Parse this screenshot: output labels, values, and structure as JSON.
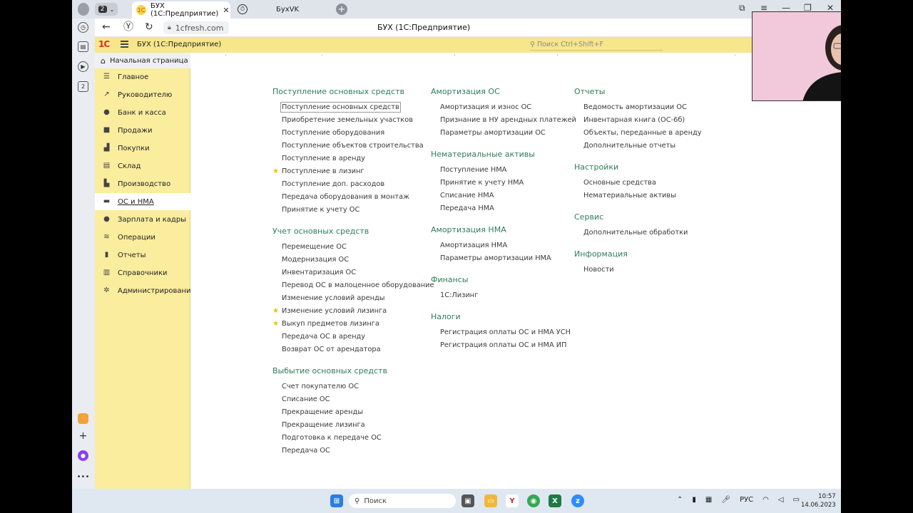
{
  "browser": {
    "profile_count": "2",
    "tabs": [
      {
        "label": "БУХ (1С:Предприятие)",
        "active": true
      },
      {
        "label": "БухVK",
        "active": false
      }
    ],
    "url": "1cfresh.com",
    "page_title": "БУХ (1С:Предприятие)",
    "rail_badge": "2"
  },
  "app": {
    "title": "БУХ  (1С:Предприятие)",
    "search_placeholder": "Поиск Ctrl+Shift+F",
    "home_tab": "Начальная страница"
  },
  "sidebar": {
    "items": [
      {
        "label": "Главное",
        "icon": "list-icon"
      },
      {
        "label": "Руководителю",
        "icon": "trend-icon"
      },
      {
        "label": "Банк и касса",
        "icon": "coin-icon"
      },
      {
        "label": "Продажи",
        "icon": "bag-icon"
      },
      {
        "label": "Покупки",
        "icon": "cart-icon"
      },
      {
        "label": "Склад",
        "icon": "box-icon"
      },
      {
        "label": "Производство",
        "icon": "factory-icon"
      },
      {
        "label": "ОС и НМА",
        "icon": "truck-icon",
        "active": true
      },
      {
        "label": "Зарплата и кадры",
        "icon": "person-icon"
      },
      {
        "label": "Операции",
        "icon": "ops-icon"
      },
      {
        "label": "Отчеты",
        "icon": "bar-chart-icon"
      },
      {
        "label": "Справочники",
        "icon": "book-icon"
      },
      {
        "label": "Администрирование",
        "icon": "gear-icon"
      }
    ]
  },
  "content": {
    "col1": [
      {
        "title": "Поступление основных средств",
        "links": [
          {
            "label": "Поступление основных средств",
            "boxed": true
          },
          {
            "label": "Приобретение земельных участков"
          },
          {
            "label": "Поступление оборудования"
          },
          {
            "label": "Поступление объектов строительства"
          },
          {
            "label": "Поступление в аренду"
          },
          {
            "label": "Поступление в лизинг",
            "star": true
          },
          {
            "label": "Поступление доп. расходов"
          },
          {
            "label": "Передача оборудования в монтаж"
          },
          {
            "label": "Принятие к учету ОС"
          }
        ]
      },
      {
        "title": "Учет основных средств",
        "links": [
          {
            "label": "Перемещение ОС"
          },
          {
            "label": "Модернизация ОС"
          },
          {
            "label": "Инвентаризация ОС"
          },
          {
            "label": "Перевод ОС в малоценное оборудование"
          },
          {
            "label": "Изменение условий аренды"
          },
          {
            "label": "Изменение условий лизинга",
            "star": true
          },
          {
            "label": "Выкуп предметов лизинга",
            "star": true
          },
          {
            "label": "Передача ОС в аренду"
          },
          {
            "label": "Возврат ОС от арендатора"
          }
        ]
      },
      {
        "title": "Выбытие основных средств",
        "links": [
          {
            "label": "Счет покупателю ОС"
          },
          {
            "label": "Списание ОС"
          },
          {
            "label": "Прекращение аренды"
          },
          {
            "label": "Прекращение лизинга"
          },
          {
            "label": "Подготовка к передаче ОС"
          },
          {
            "label": "Передача ОС"
          }
        ]
      }
    ],
    "col2": [
      {
        "title": "Амортизация ОС",
        "links": [
          {
            "label": "Амортизация и износ ОС"
          },
          {
            "label": "Признание в НУ арендных платежей"
          },
          {
            "label": "Параметры амортизации ОС"
          }
        ]
      },
      {
        "title": "Нематериальные активы",
        "links": [
          {
            "label": "Поступление НМА"
          },
          {
            "label": "Принятие к учету НМА"
          },
          {
            "label": "Списание НМА"
          },
          {
            "label": "Передача НМА"
          }
        ]
      },
      {
        "title": "Амортизация НМА",
        "links": [
          {
            "label": "Амортизация НМА"
          },
          {
            "label": "Параметры амортизации НМА"
          }
        ]
      },
      {
        "title": "Финансы",
        "links": [
          {
            "label": "1С:Лизинг"
          }
        ]
      },
      {
        "title": "Налоги",
        "links": [
          {
            "label": "Регистрация оплаты ОС и НМА УСН"
          },
          {
            "label": "Регистрация оплаты ОС и НМА ИП"
          }
        ]
      }
    ],
    "col3": [
      {
        "title": "Отчеты",
        "links": [
          {
            "label": "Ведомость амортизации ОС"
          },
          {
            "label": "Инвентарная книга (ОС-6б)"
          },
          {
            "label": "Объекты, переданные в аренду"
          },
          {
            "label": "Дополнительные отчеты"
          }
        ]
      },
      {
        "title": "Настройки",
        "links": [
          {
            "label": "Основные средства"
          },
          {
            "label": "Нематериальные активы"
          }
        ]
      },
      {
        "title": "Сервис",
        "links": [
          {
            "label": "Дополнительные обработки"
          }
        ]
      },
      {
        "title": "Информация",
        "links": [
          {
            "label": "Новости"
          }
        ]
      }
    ]
  },
  "taskbar": {
    "search_label": "Поиск",
    "language": "РУС",
    "time": "10:57",
    "date": "14.06.2023"
  },
  "colors": {
    "accent_yellow": "#f7e68a",
    "sidebar_yellow": "#fbed9e",
    "section_green": "#2f7d5b",
    "star": "#f0c000"
  }
}
